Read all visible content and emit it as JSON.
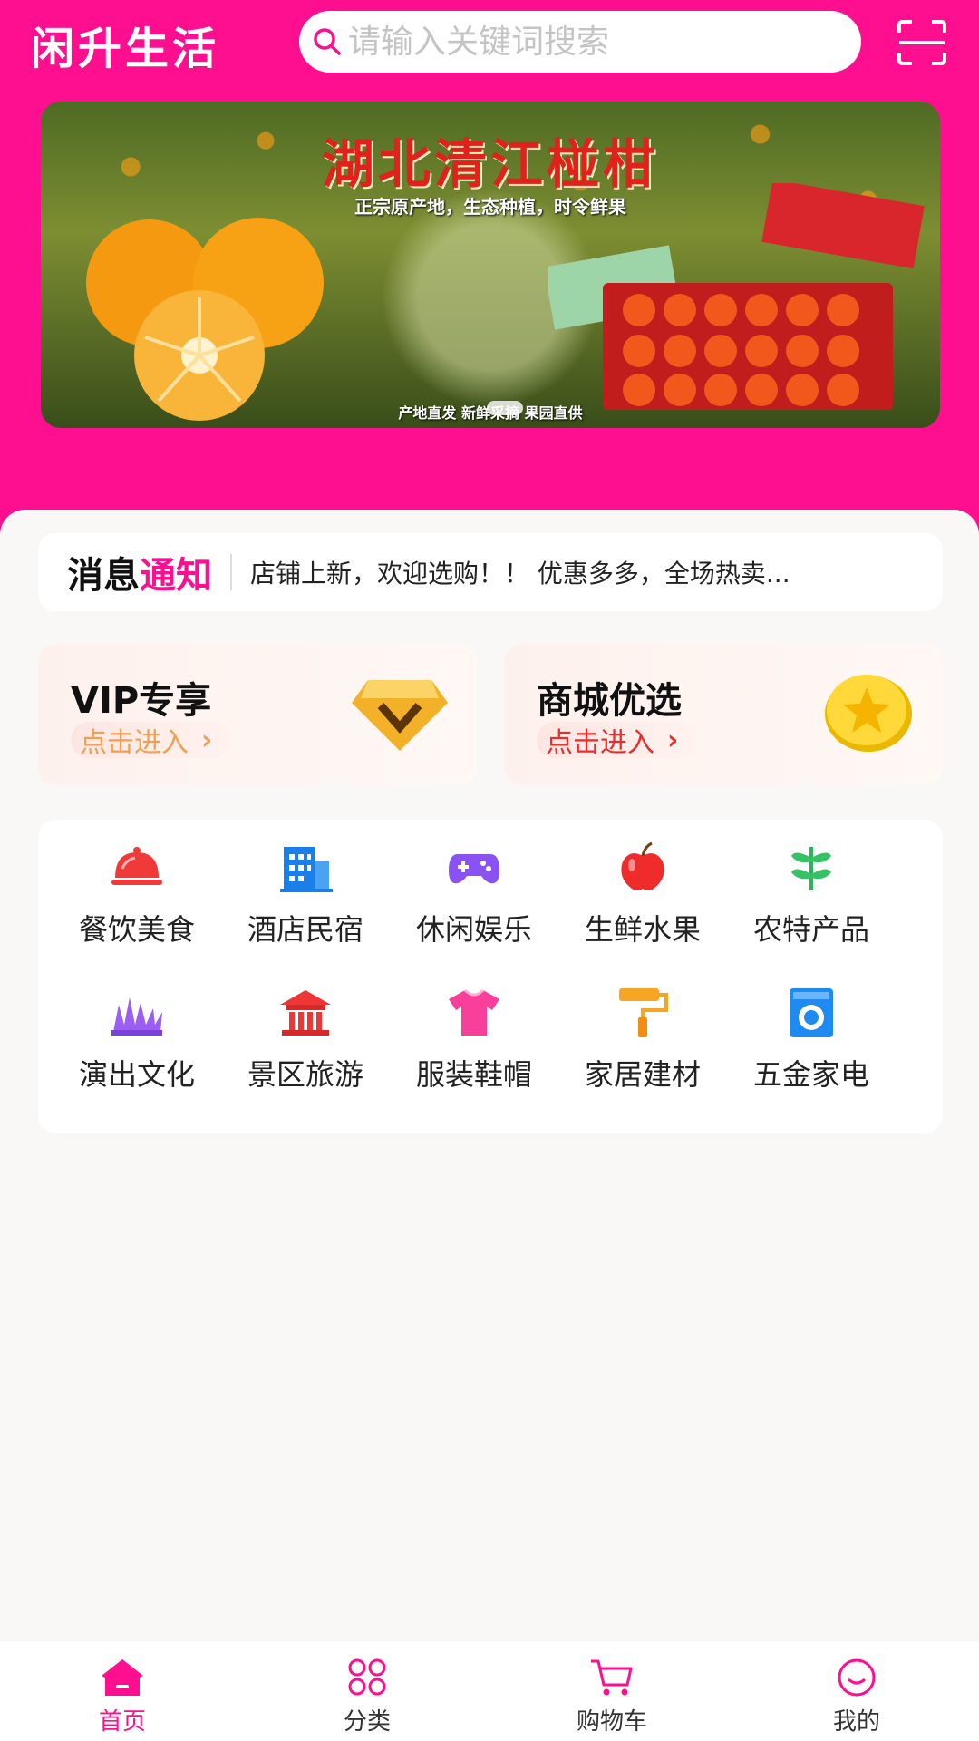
{
  "header": {
    "app_title": "闲升生活",
    "search_placeholder": "请输入关键词搜索"
  },
  "banner": {
    "title": "湖北清江椪柑",
    "subtitle": "正宗原产地，生态种植，时令鲜果",
    "footer": "产地直发 新鲜采摘 果园直供"
  },
  "notice": {
    "title_part1": "消息",
    "title_part2": "通知",
    "text": "店铺上新，欢迎选购！！ 优惠多多，全场热卖..."
  },
  "promos": [
    {
      "title": "VIP专享",
      "link": "点击进入",
      "icon": "diamond-icon"
    },
    {
      "title": "商城优选",
      "link": "点击进入",
      "icon": "gold-coin-icon"
    }
  ],
  "categories": [
    {
      "label": "餐饮美食",
      "icon": "dish-cover-icon"
    },
    {
      "label": "酒店民宿",
      "icon": "hotel-building-icon"
    },
    {
      "label": "休闲娱乐",
      "icon": "gamepad-icon"
    },
    {
      "label": "生鲜水果",
      "icon": "apple-icon"
    },
    {
      "label": "农特产品",
      "icon": "sprout-icon"
    },
    {
      "label": "演出文化",
      "icon": "grass-stage-icon"
    },
    {
      "label": "景区旅游",
      "icon": "temple-icon"
    },
    {
      "label": "服装鞋帽",
      "icon": "tshirt-icon"
    },
    {
      "label": "家居建材",
      "icon": "paint-roller-icon"
    },
    {
      "label": "五金家电",
      "icon": "washing-machine-icon"
    }
  ],
  "tabbar": [
    {
      "label": "首页",
      "icon": "home-icon",
      "active": true
    },
    {
      "label": "分类",
      "icon": "category-icon",
      "active": false
    },
    {
      "label": "购物车",
      "icon": "cart-icon",
      "active": false
    },
    {
      "label": "我的",
      "icon": "profile-icon",
      "active": false
    }
  ],
  "colors": {
    "brand": "#fe0f8f",
    "page_bg": "#f9f8f7"
  }
}
